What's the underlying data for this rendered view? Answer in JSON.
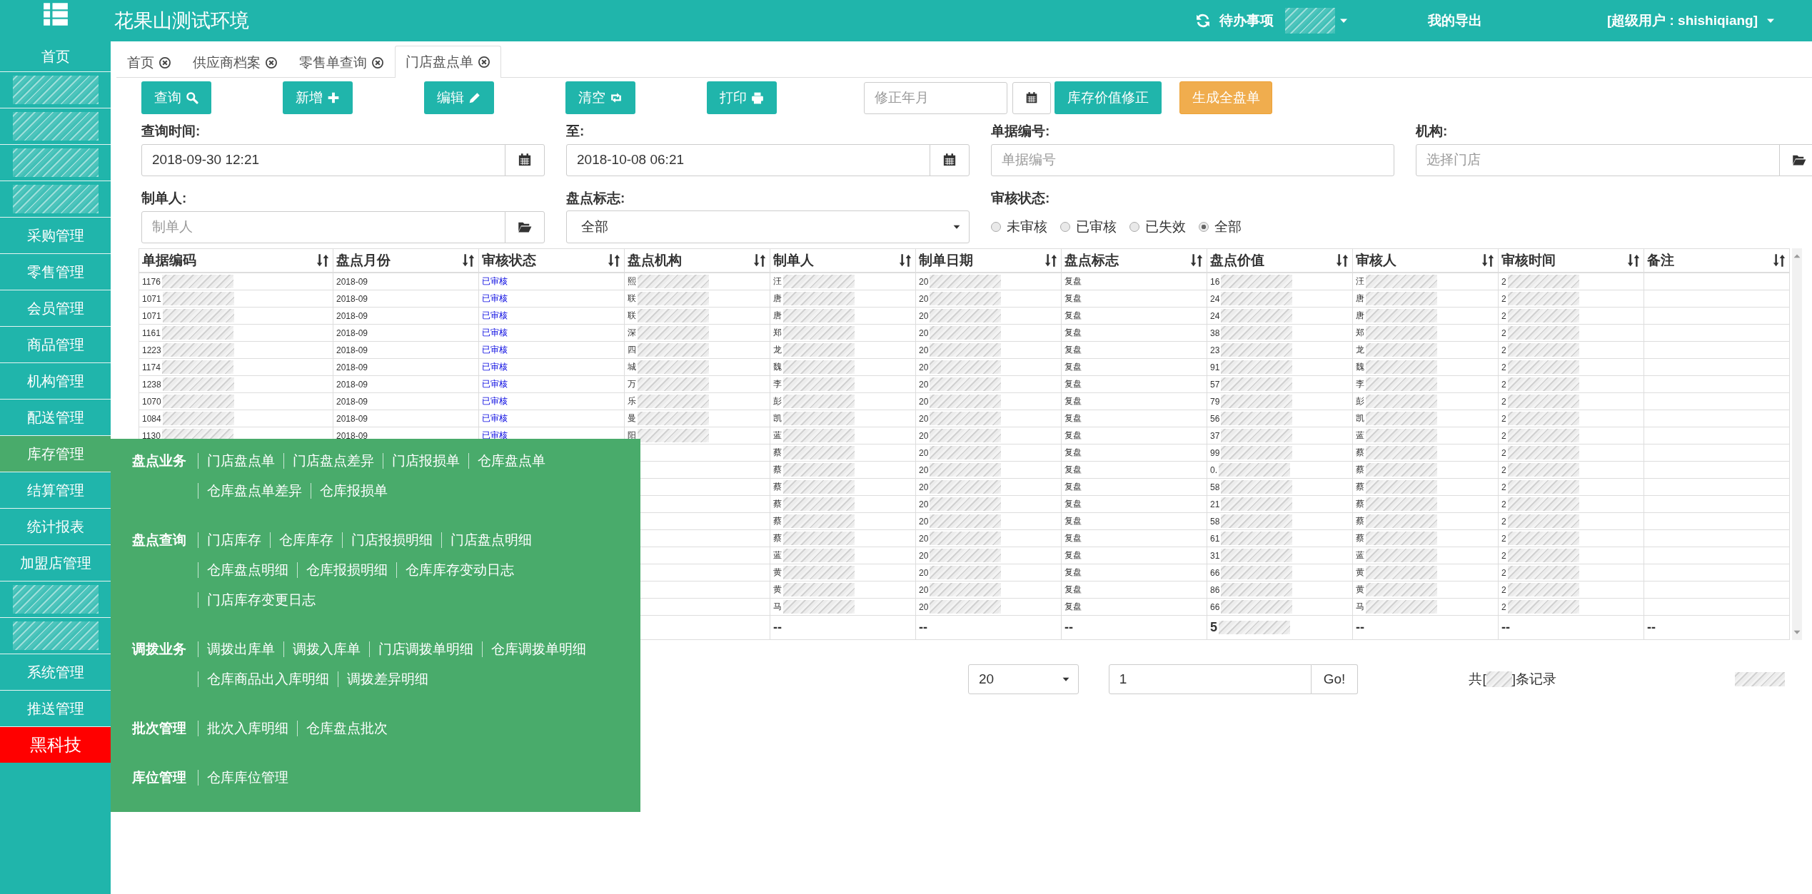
{
  "header": {
    "title": "花果山测试环境",
    "todo": "待办事项",
    "exports": "我的导出",
    "user": "[超级用户 : shishiqiang]"
  },
  "sidebar": {
    "items": [
      {
        "label": "首页",
        "kind": "normal",
        "selected": false
      },
      {
        "kind": "redacted",
        "selected": false
      },
      {
        "kind": "redacted",
        "selected": false
      },
      {
        "kind": "redacted",
        "selected": false
      },
      {
        "kind": "redacted",
        "selected": false
      },
      {
        "label": "采购管理",
        "kind": "normal",
        "selected": false
      },
      {
        "label": "零售管理",
        "kind": "normal",
        "selected": false
      },
      {
        "label": "会员管理",
        "kind": "normal",
        "selected": false
      },
      {
        "label": "商品管理",
        "kind": "normal",
        "selected": false
      },
      {
        "label": "机构管理",
        "kind": "normal",
        "selected": false
      },
      {
        "label": "配送管理",
        "kind": "normal",
        "selected": false
      },
      {
        "label": "库存管理",
        "kind": "normal",
        "selected": true
      },
      {
        "label": "结算管理",
        "kind": "normal",
        "selected": false
      },
      {
        "label": "统计报表",
        "kind": "normal",
        "selected": false
      },
      {
        "label": "加盟店管理",
        "kind": "normal",
        "selected": false
      },
      {
        "kind": "redacted",
        "selected": false
      },
      {
        "kind": "redacted",
        "selected": false
      },
      {
        "label": "系统管理",
        "kind": "normal",
        "selected": false
      },
      {
        "label": "推送管理",
        "kind": "normal",
        "selected": false
      },
      {
        "label": "黑科技",
        "kind": "alert",
        "selected": false
      }
    ]
  },
  "tabs": [
    {
      "label": "首页",
      "selected": false
    },
    {
      "label": "供应商档案",
      "selected": false
    },
    {
      "label": "零售单查询",
      "selected": false
    },
    {
      "label": "门店盘点单",
      "selected": true
    }
  ],
  "toolbar": {
    "buttons": [
      {
        "label": "查询"
      },
      {
        "label": "新增"
      },
      {
        "label": "编辑"
      },
      {
        "label": "清空"
      },
      {
        "label": "打印"
      }
    ],
    "month_field": {
      "placeholder": "修正年月"
    },
    "actions": [
      {
        "label": "库存价值修正",
        "kind": "primary"
      },
      {
        "label": "生成全盘单",
        "kind": "warning"
      }
    ]
  },
  "filters": [
    {
      "label": "查询时间:",
      "kind": "date",
      "value": "2018-09-30 12:21"
    },
    {
      "label": "至:",
      "kind": "date",
      "value": "2018-10-08 06:21"
    },
    {
      "label": "单据编号:",
      "kind": "input",
      "placeholder": "单据编号"
    },
    {
      "label": "机构:",
      "kind": "lookup",
      "placeholder": "选择门店"
    },
    {
      "label": "制单人:",
      "kind": "lookup",
      "placeholder": "制单人"
    },
    {
      "label": "盘点标志:",
      "kind": "select",
      "value": "全部"
    },
    {
      "label": "审核状态:",
      "kind": "radio",
      "options": [
        {
          "label": "未审核",
          "selected": false
        },
        {
          "label": "已审核",
          "selected": false
        },
        {
          "label": "已失效",
          "selected": false
        },
        {
          "label": "全部",
          "selected": true
        }
      ]
    }
  ],
  "table": {
    "columns": [
      {
        "label": "单据编码",
        "redacted": true
      },
      {
        "label": "盘点月份",
        "redacted": false
      },
      {
        "label": "审核状态",
        "kind": "status",
        "redacted": false
      },
      {
        "label": "盘点机构",
        "redacted": true
      },
      {
        "label": "制单人",
        "redacted": true
      },
      {
        "label": "制单日期",
        "redacted": true
      },
      {
        "label": "盘点标志",
        "redacted": false
      },
      {
        "label": "盘点价值",
        "redacted": true
      },
      {
        "label": "审核人",
        "redacted": true
      },
      {
        "label": "审核时间",
        "redacted": true
      },
      {
        "label": "备注",
        "redacted": false
      }
    ],
    "rows": [
      [
        "1176",
        "2018-09",
        "已审核",
        "熙",
        "汪",
        "20",
        "复盘",
        "16",
        "汪",
        "2",
        null
      ],
      [
        "1071",
        "2018-09",
        "已审核",
        "联",
        "唐",
        "20",
        "复盘",
        "24",
        "唐",
        "2",
        null
      ],
      [
        "1071",
        "2018-09",
        "已审核",
        "联",
        "唐",
        "20",
        "复盘",
        "24",
        "唐",
        "2",
        null
      ],
      [
        "1161",
        "2018-09",
        "已审核",
        "深",
        "郑",
        "20",
        "复盘",
        "38",
        "郑",
        "2",
        null
      ],
      [
        "1223",
        "2018-09",
        "已审核",
        "四",
        "龙",
        "20",
        "复盘",
        "23",
        "龙",
        "2",
        null
      ],
      [
        "1174",
        "2018-09",
        "已审核",
        "城",
        "魏",
        "20",
        "复盘",
        "91",
        "魏",
        "2",
        null
      ],
      [
        "1238",
        "2018-09",
        "已审核",
        "万",
        "李",
        "20",
        "复盘",
        "57",
        "李",
        "2",
        null
      ],
      [
        "1070",
        "2018-09",
        "已审核",
        "乐",
        "彭",
        "20",
        "复盘",
        "79",
        "彭",
        "2",
        null
      ],
      [
        "1084",
        "2018-09",
        "已审核",
        "曼",
        "凯",
        "20",
        "复盘",
        "56",
        "凯",
        "2",
        null
      ],
      [
        "1130",
        "2018-09",
        "已审核",
        "阳",
        "蓝",
        "20",
        "复盘",
        "37",
        "蓝",
        "2",
        null
      ],
      [
        null,
        null,
        null,
        null,
        "蔡",
        "20",
        "复盘",
        "99",
        "蔡",
        "2",
        null
      ],
      [
        null,
        null,
        null,
        null,
        "蔡",
        "20",
        "复盘",
        "0.",
        "蔡",
        "2",
        null
      ],
      [
        null,
        null,
        null,
        null,
        "蔡",
        "20",
        "复盘",
        "58",
        "蔡",
        "2",
        null
      ],
      [
        null,
        null,
        null,
        null,
        "蔡",
        "20",
        "复盘",
        "21",
        "蔡",
        "2",
        null
      ],
      [
        null,
        null,
        null,
        null,
        "蔡",
        "20",
        "复盘",
        "58",
        "蔡",
        "2",
        null
      ],
      [
        null,
        null,
        null,
        null,
        "蔡",
        "20",
        "复盘",
        "61",
        "蔡",
        "2",
        null
      ],
      [
        null,
        null,
        null,
        null,
        "蓝",
        "20",
        "复盘",
        "31",
        "蓝",
        "2",
        null
      ],
      [
        null,
        null,
        null,
        null,
        "黄",
        "20",
        "复盘",
        "66",
        "黄",
        "2",
        null
      ],
      [
        null,
        null,
        null,
        null,
        "黄",
        "20",
        "复盘",
        "86",
        "黄",
        "2",
        null
      ],
      [
        null,
        null,
        null,
        null,
        "马",
        "20",
        "复盘",
        "66",
        "马",
        "2",
        null
      ]
    ]
  },
  "table_footer": {
    "cells": [
      {
        "text": "--",
        "redacted": false
      },
      {
        "text": "--",
        "redacted": false
      },
      {
        "text": "--",
        "redacted": false
      },
      {
        "text": "5",
        "redacted": true
      },
      {
        "text": "--",
        "redacted": false
      },
      {
        "text": "--",
        "redacted": false
      },
      {
        "text": "--",
        "redacted": false
      }
    ]
  },
  "pagination": {
    "page_size": "20",
    "page": "1",
    "go": "Go!",
    "total_prefix": "共[",
    "total_suffix": "]条记录"
  },
  "menu": {
    "groups": [
      {
        "title": "盘点业务",
        "links": [
          "门店盘点单",
          "门店盘点差异",
          "门店报损单",
          "仓库盘点单",
          "仓库盘点单差异",
          "仓库报损单"
        ]
      },
      {
        "title": "盘点查询",
        "links": [
          "门店库存",
          "仓库库存",
          "门店报损明细",
          "门店盘点明细",
          "仓库盘点明细",
          "仓库报损明细",
          "仓库库存变动日志",
          "门店库存变更日志"
        ]
      },
      {
        "title": "调拨业务",
        "links": [
          "调拨出库单",
          "调拨入库单",
          "门店调拨单明细",
          "仓库调拨单明细",
          "仓库商品出入库明细",
          "调拨差异明细"
        ]
      },
      {
        "title": "批次管理",
        "links": [
          "批次入库明细",
          "仓库盘点批次"
        ]
      },
      {
        "title": "库位管理",
        "links": [
          "仓库库位管理"
        ]
      }
    ]
  }
}
